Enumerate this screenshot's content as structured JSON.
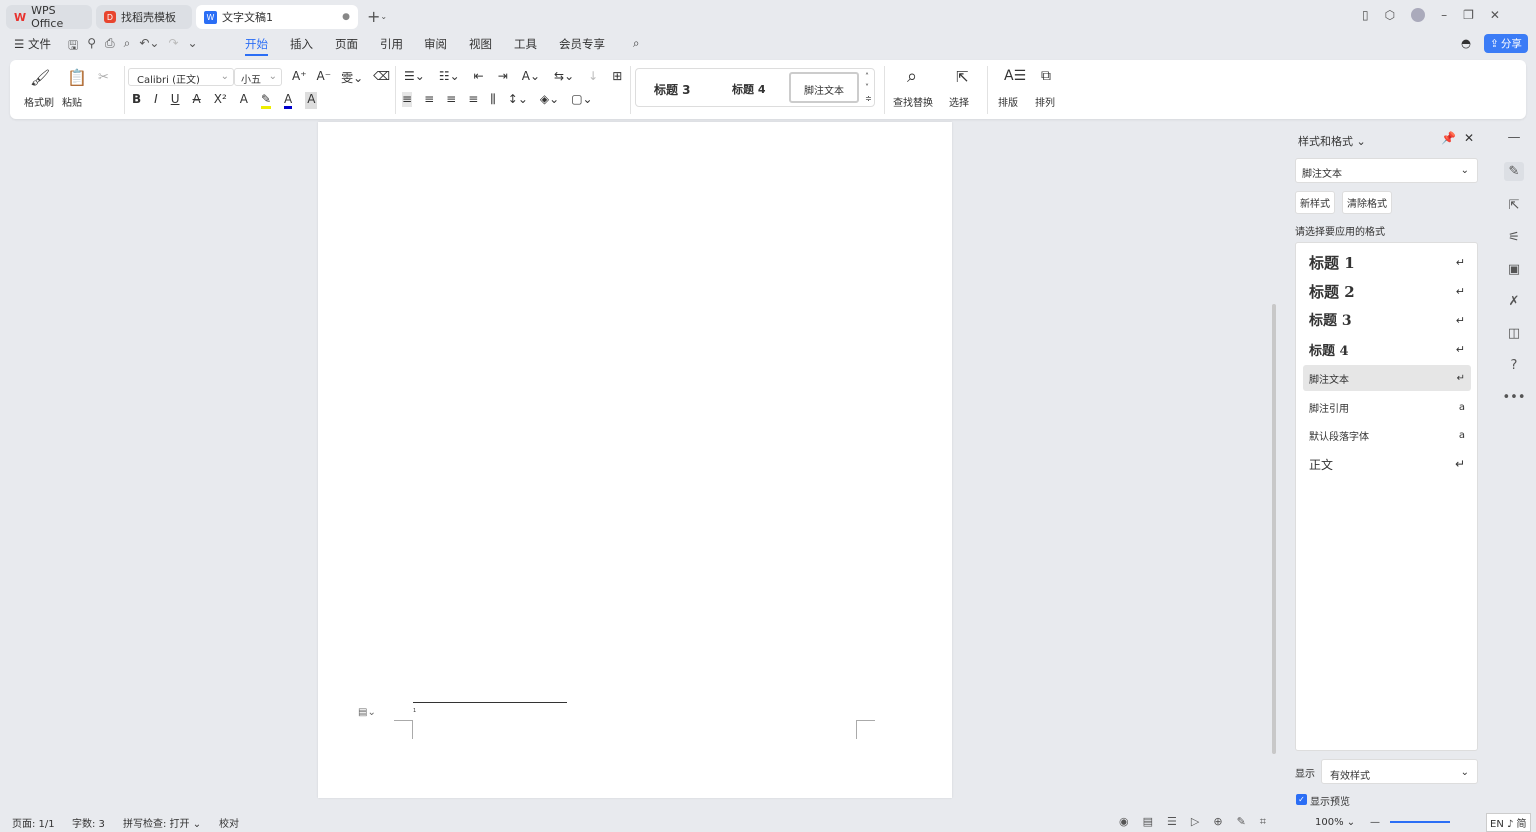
{
  "tabs": [
    {
      "label": "WPS Office",
      "icon": "wps-logo-icon"
    },
    {
      "label": "找稻壳模板",
      "icon": "docer-icon"
    },
    {
      "label": "文字文稿1",
      "icon": "word-doc-icon",
      "active": true
    }
  ],
  "menu": {
    "file": "文件",
    "items": [
      "开始",
      "插入",
      "页面",
      "引用",
      "审阅",
      "视图",
      "工具",
      "会员专享"
    ],
    "active": "开始",
    "share": "分享"
  },
  "ribbon": {
    "format_painter": "格式刷",
    "paste": "粘贴",
    "font": "Calibri (正文)",
    "size": "小五",
    "styles": [
      "标题 3",
      "标题 4",
      "脚注文本"
    ],
    "find_replace": "查找替换",
    "select": "选择",
    "layout": "排版",
    "arrange": "排列"
  },
  "panel": {
    "title": "样式和格式",
    "current": "脚注文本",
    "new_style": "新样式",
    "clear_format": "清除格式",
    "prompt": "请选择要应用的格式",
    "styles": [
      {
        "label": "标题  1",
        "kind": "h"
      },
      {
        "label": "标题  2",
        "kind": "h"
      },
      {
        "label": "标题  3",
        "kind": "h"
      },
      {
        "label": "标题 4",
        "kind": "h"
      },
      {
        "label": "脚注文本",
        "kind": "p",
        "selected": true
      },
      {
        "label": "脚注引用",
        "kind": "c"
      },
      {
        "label": "默认段落字体",
        "kind": "c"
      },
      {
        "label": "正文",
        "kind": "p"
      }
    ],
    "show_label": "显示",
    "show_value": "有效样式",
    "preview_label": "显示预览",
    "preview_checked": true
  },
  "document": {
    "footnote_number": "1"
  },
  "status": {
    "page": "页面: 1/1",
    "words": "字数: 3",
    "spell": "拼写检查: 打开",
    "proof": "校对",
    "zoom": "100%",
    "ime": "EN ♪ 简"
  },
  "colors": {
    "accent": "#2b6ef5",
    "share_bg": "#3b7cf6"
  }
}
